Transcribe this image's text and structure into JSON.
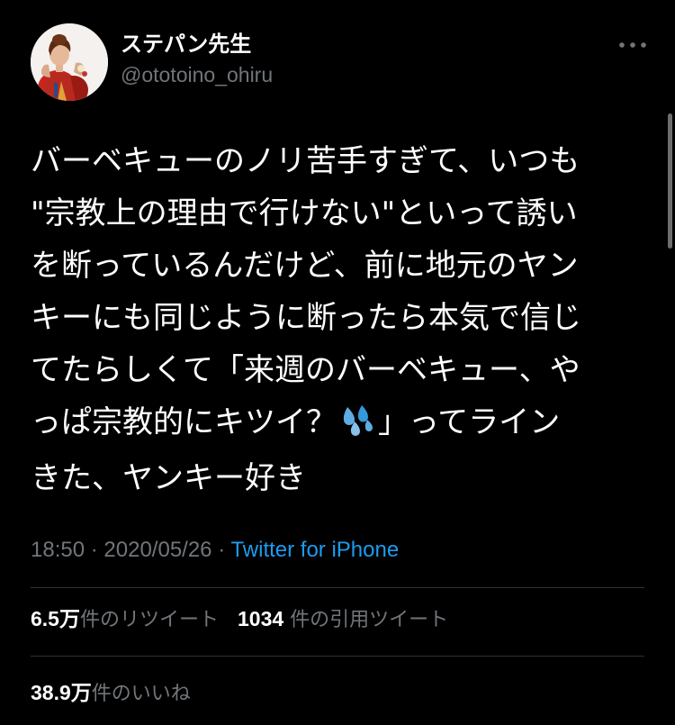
{
  "user": {
    "display_name": "ステパン先生",
    "handle": "@ototoino_ohiru",
    "avatar": "profile-photo"
  },
  "tweet": {
    "lines": [
      "バーベキューのノリ苦手すぎて、いつも",
      "\"宗教上の理由で行けない\"といって誘い",
      "を断っているんだけど、前に地元のヤン",
      "キーにも同じように断ったら本気で信じ",
      "てたらしくて「来週のバーベキュー、や",
      "っぱ宗教的にキツイ？",
      "」ってライン",
      "きた、ヤンキー好き"
    ],
    "emoji": "sweat-droplets-emoji"
  },
  "meta": {
    "time": "18:50",
    "separator": "·",
    "date": "2020/05/26",
    "source": "Twitter for iPhone"
  },
  "stats": {
    "retweets_count": "6.5",
    "retweets_unit": "万",
    "retweets_label": "件のリツイート",
    "quotes_count": "1034",
    "quotes_label": "件の引用ツイート",
    "likes_count": "38.9",
    "likes_unit": "万",
    "likes_label": "件のいいね"
  },
  "colors": {
    "background": "#000000",
    "text": "#ffffff",
    "secondary": "#71767b",
    "link": "#1d9bf0",
    "divider": "#2f3336"
  },
  "icons": {
    "more": "more-horizontal-icon"
  }
}
